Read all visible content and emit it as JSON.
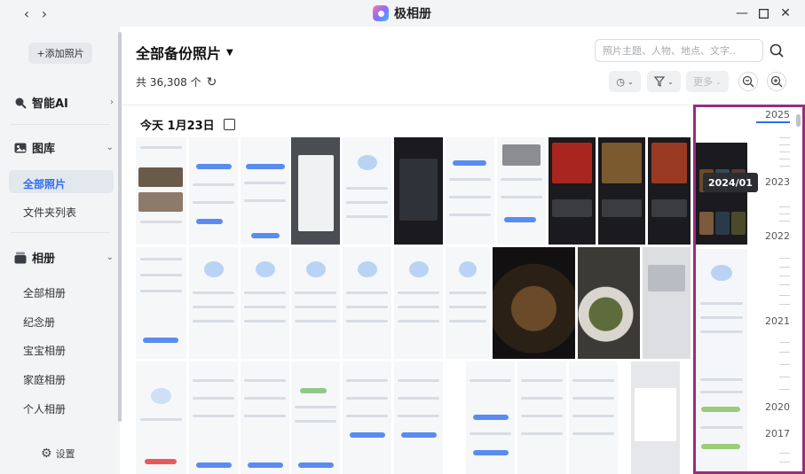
{
  "window": {
    "title": "极相册",
    "back_icon": "‹",
    "forward_icon": "›",
    "min_icon": "—",
    "max_icon": "□",
    "close_icon": "✕"
  },
  "sidebar": {
    "add_photo": "+添加照片",
    "sections": {
      "ai": "智能AI",
      "library": "图库",
      "albums": "相册"
    },
    "library_items": [
      "全部照片",
      "文件夹列表"
    ],
    "album_items": [
      "全部相册",
      "纪念册",
      "宝宝相册",
      "家庭相册",
      "个人相册"
    ],
    "settings": "设置"
  },
  "main": {
    "title": "全部备份照片",
    "count": "共 36,308 个",
    "search_placeholder": "照片主题、人物、地点、文字...",
    "more_label": "更多",
    "date_header": "今天 1月23日"
  },
  "timeline": {
    "years": [
      "2025",
      "2023",
      "2022",
      "2021",
      "2020",
      "2017"
    ],
    "tooltip": "2024/01"
  },
  "colors": {
    "accent": "#2b6ef5",
    "highlight_border": "#9b2c7e"
  }
}
